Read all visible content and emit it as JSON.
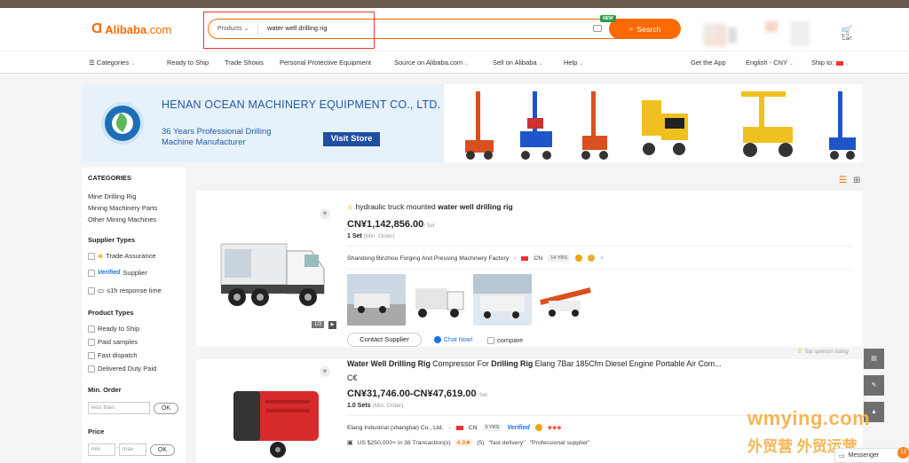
{
  "header": {
    "logo_mark": "Ɑ",
    "logo_name": "Alibaba",
    "logo_domain": ".com",
    "search": {
      "category": "Products",
      "query": "water well drilling rig",
      "button_label": "Search",
      "new_badge": "NEW"
    },
    "cart_label": "Cart"
  },
  "nav": {
    "categories": "Categories",
    "items": [
      "Ready to Ship",
      "Trade Shows",
      "Personal Protective Equipment",
      "Source on Alibaba.com",
      "Sell on Alibaba",
      "Help"
    ],
    "get_app": "Get the App",
    "lang_currency": "English - CNY",
    "ship_to": "Ship to:"
  },
  "banner": {
    "company": "HENAN OCEAN MACHINERY EQUIPMENT CO., LTD.",
    "tagline": "36 Years Professional Drilling Machine Manufacturer",
    "button": "Visit Store"
  },
  "sidebar": {
    "categories_title": "CATEGORIES",
    "categories": [
      "Mine Drilling Rig",
      "Mining Machinery Parts",
      "Other Mining Machines"
    ],
    "supplier_types_title": "Supplier Types",
    "trade_assurance": "Trade Assurance",
    "verified_badge": "Verified",
    "verified_supplier": "Supplier",
    "response_time": "≤1h response time",
    "product_types_title": "Product Types",
    "product_types": [
      "Ready to Ship",
      "Paid samples",
      "Fast dispatch",
      "Delivered Duty Paid"
    ],
    "min_order_title": "Min. Order",
    "less_than": "less than",
    "ok": "OK",
    "price_title": "Price",
    "min": "min",
    "dash": "-",
    "max": "max"
  },
  "products": [
    {
      "title_pre": "hydraulic truck mounted ",
      "title_bold": "water well drilling rig",
      "price": "CN¥1,142,856.00",
      "unit": "/ Set",
      "moq": "1 Set",
      "moq_note": "(Min. Order)",
      "supplier": "Shandong Binzhou Forging And Pressing Machinery Factory",
      "country": "CN",
      "years": "14 YRS",
      "pager": "1/3",
      "contact": "Contact Supplier",
      "chat": "Chat Now!",
      "compare": "compare",
      "sponsor": "Top sponsor listing"
    },
    {
      "title_b1": "Water Well Drilling Rig",
      "title_m1": " Compressor For ",
      "title_b2": "Drilling Rig",
      "title_m2": " Elang 7Bar 185Cfm Diesel Engine Portable Air Com...",
      "cert": "C€",
      "price": "CN¥31,746.00-CN¥47,619.00",
      "unit": "/ Set",
      "moq": "1.0 Sets",
      "moq_note": "(Min. Order)",
      "supplier": "Elang Industrial (shanghai) Co., Ltd.",
      "country": "CN",
      "years": "9 YRS",
      "verified": "Verified",
      "transactions": "US $250,000+ in 38 Transaction(s)",
      "rating": "4.9★",
      "review_count": "(5)",
      "review_1": "\"fast delivery\"",
      "review_2": "\"Professional supplier\""
    }
  ],
  "watermark": {
    "line1": "wmying.com",
    "line2": "外贸营 外贸运营"
  },
  "messenger": {
    "label": "Messenger",
    "count": "12"
  },
  "colors": {
    "brand": "#ff6a00",
    "banner_blue": "#1f5aa6",
    "link_blue": "#1a73e8"
  }
}
